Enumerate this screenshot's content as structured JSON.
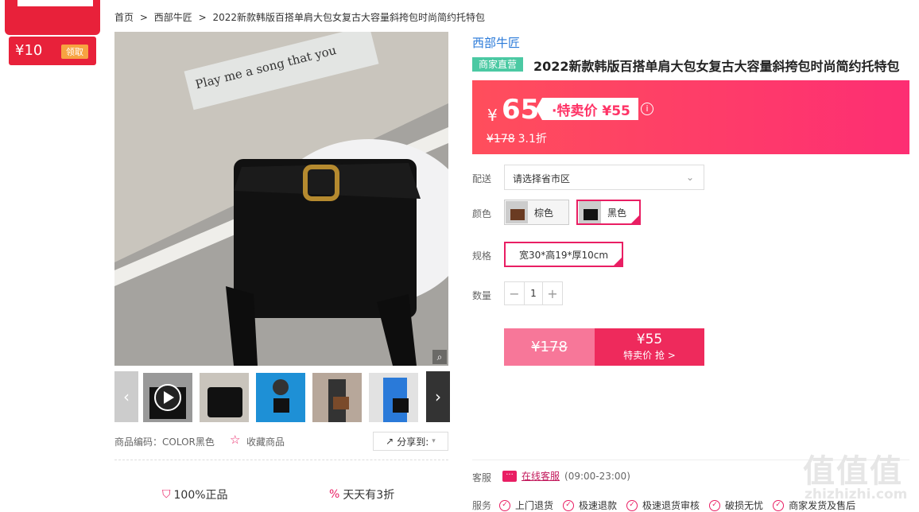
{
  "coupon": {
    "amount": "¥10",
    "get_label": "领取"
  },
  "breadcrumb": [
    "首页",
    ">",
    "西部牛匠",
    ">",
    "2022新款韩版百搭单肩大包女复古大容量斜挎包时尚简约托特包"
  ],
  "product": {
    "shop_name": "西部牛匠",
    "tag": "商家直营",
    "title": "2022新款韩版百搭单肩大包女复古大容量斜挎包时尚简约托特包",
    "image_text": "Play me a song that you"
  },
  "price": {
    "yen": "¥",
    "current": "65",
    "special_label": "·特卖价 ¥55",
    "info_icon": "i",
    "original": "¥178",
    "discount": "3.1折"
  },
  "delivery": {
    "label": "配送",
    "placeholder": "请选择省市区"
  },
  "color": {
    "label": "颜色",
    "options": [
      "棕色",
      "黑色"
    ],
    "selected": "黑色"
  },
  "spec": {
    "label": "规格",
    "value": "宽30*高19*厚10cm"
  },
  "quantity": {
    "label": "数量",
    "minus": "−",
    "value": "1",
    "plus": "+"
  },
  "buy": {
    "orig_price": "¥178",
    "price": "¥55",
    "action": "特卖价 抢 >"
  },
  "meta": {
    "sku": "商品编码：COLOR黑色",
    "favorite": "收藏商品",
    "share": "分享到:"
  },
  "guarantees": [
    "100%正品",
    "天天有3折"
  ],
  "service": {
    "cs_label": "客服",
    "cs_link": "在线客服",
    "cs_hours": "(09:00-23:00)",
    "svc_label": "服务",
    "items": [
      "上门退货",
      "极速退款",
      "极速退货审核",
      "破损无忧",
      "商家发货及售后"
    ]
  },
  "watermark": {
    "big": "值值值",
    "small": "zhizhizhi.com"
  },
  "colors": {
    "brand": "#fd2e73",
    "accent": "#e91e63",
    "shop": "#2a7ad9",
    "tag": "#4bc9a3"
  }
}
